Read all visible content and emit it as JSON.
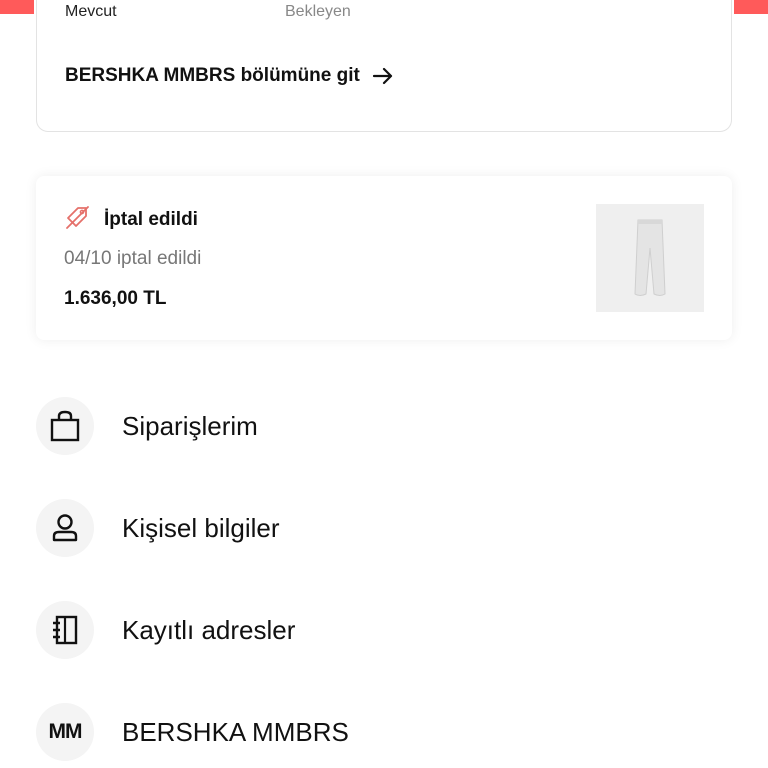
{
  "theme": {
    "accent": "#ff5a5a",
    "cancel_icon_color": "#e5706a"
  },
  "membership": {
    "status_current": "Mevcut",
    "status_pending": "Bekleyen",
    "link_label": "BERSHKA MMBRS bölümüne git"
  },
  "order": {
    "status": "İptal edildi",
    "date_text": "04/10 iptal edildi",
    "price": "1.636,00 TL",
    "status_icon": "cancelled-tag-icon",
    "thumbnail": "trousers-product-image"
  },
  "menu": {
    "items": [
      {
        "label": "Siparişlerim",
        "icon": "shopping-bag-icon"
      },
      {
        "label": "Kişisel bilgiler",
        "icon": "user-icon"
      },
      {
        "label": "Kayıtlı adresler",
        "icon": "address-book-icon"
      },
      {
        "label": "BERSHKA MMBRS",
        "icon": "mm-logo-icon",
        "logo_text": "MM"
      }
    ]
  }
}
